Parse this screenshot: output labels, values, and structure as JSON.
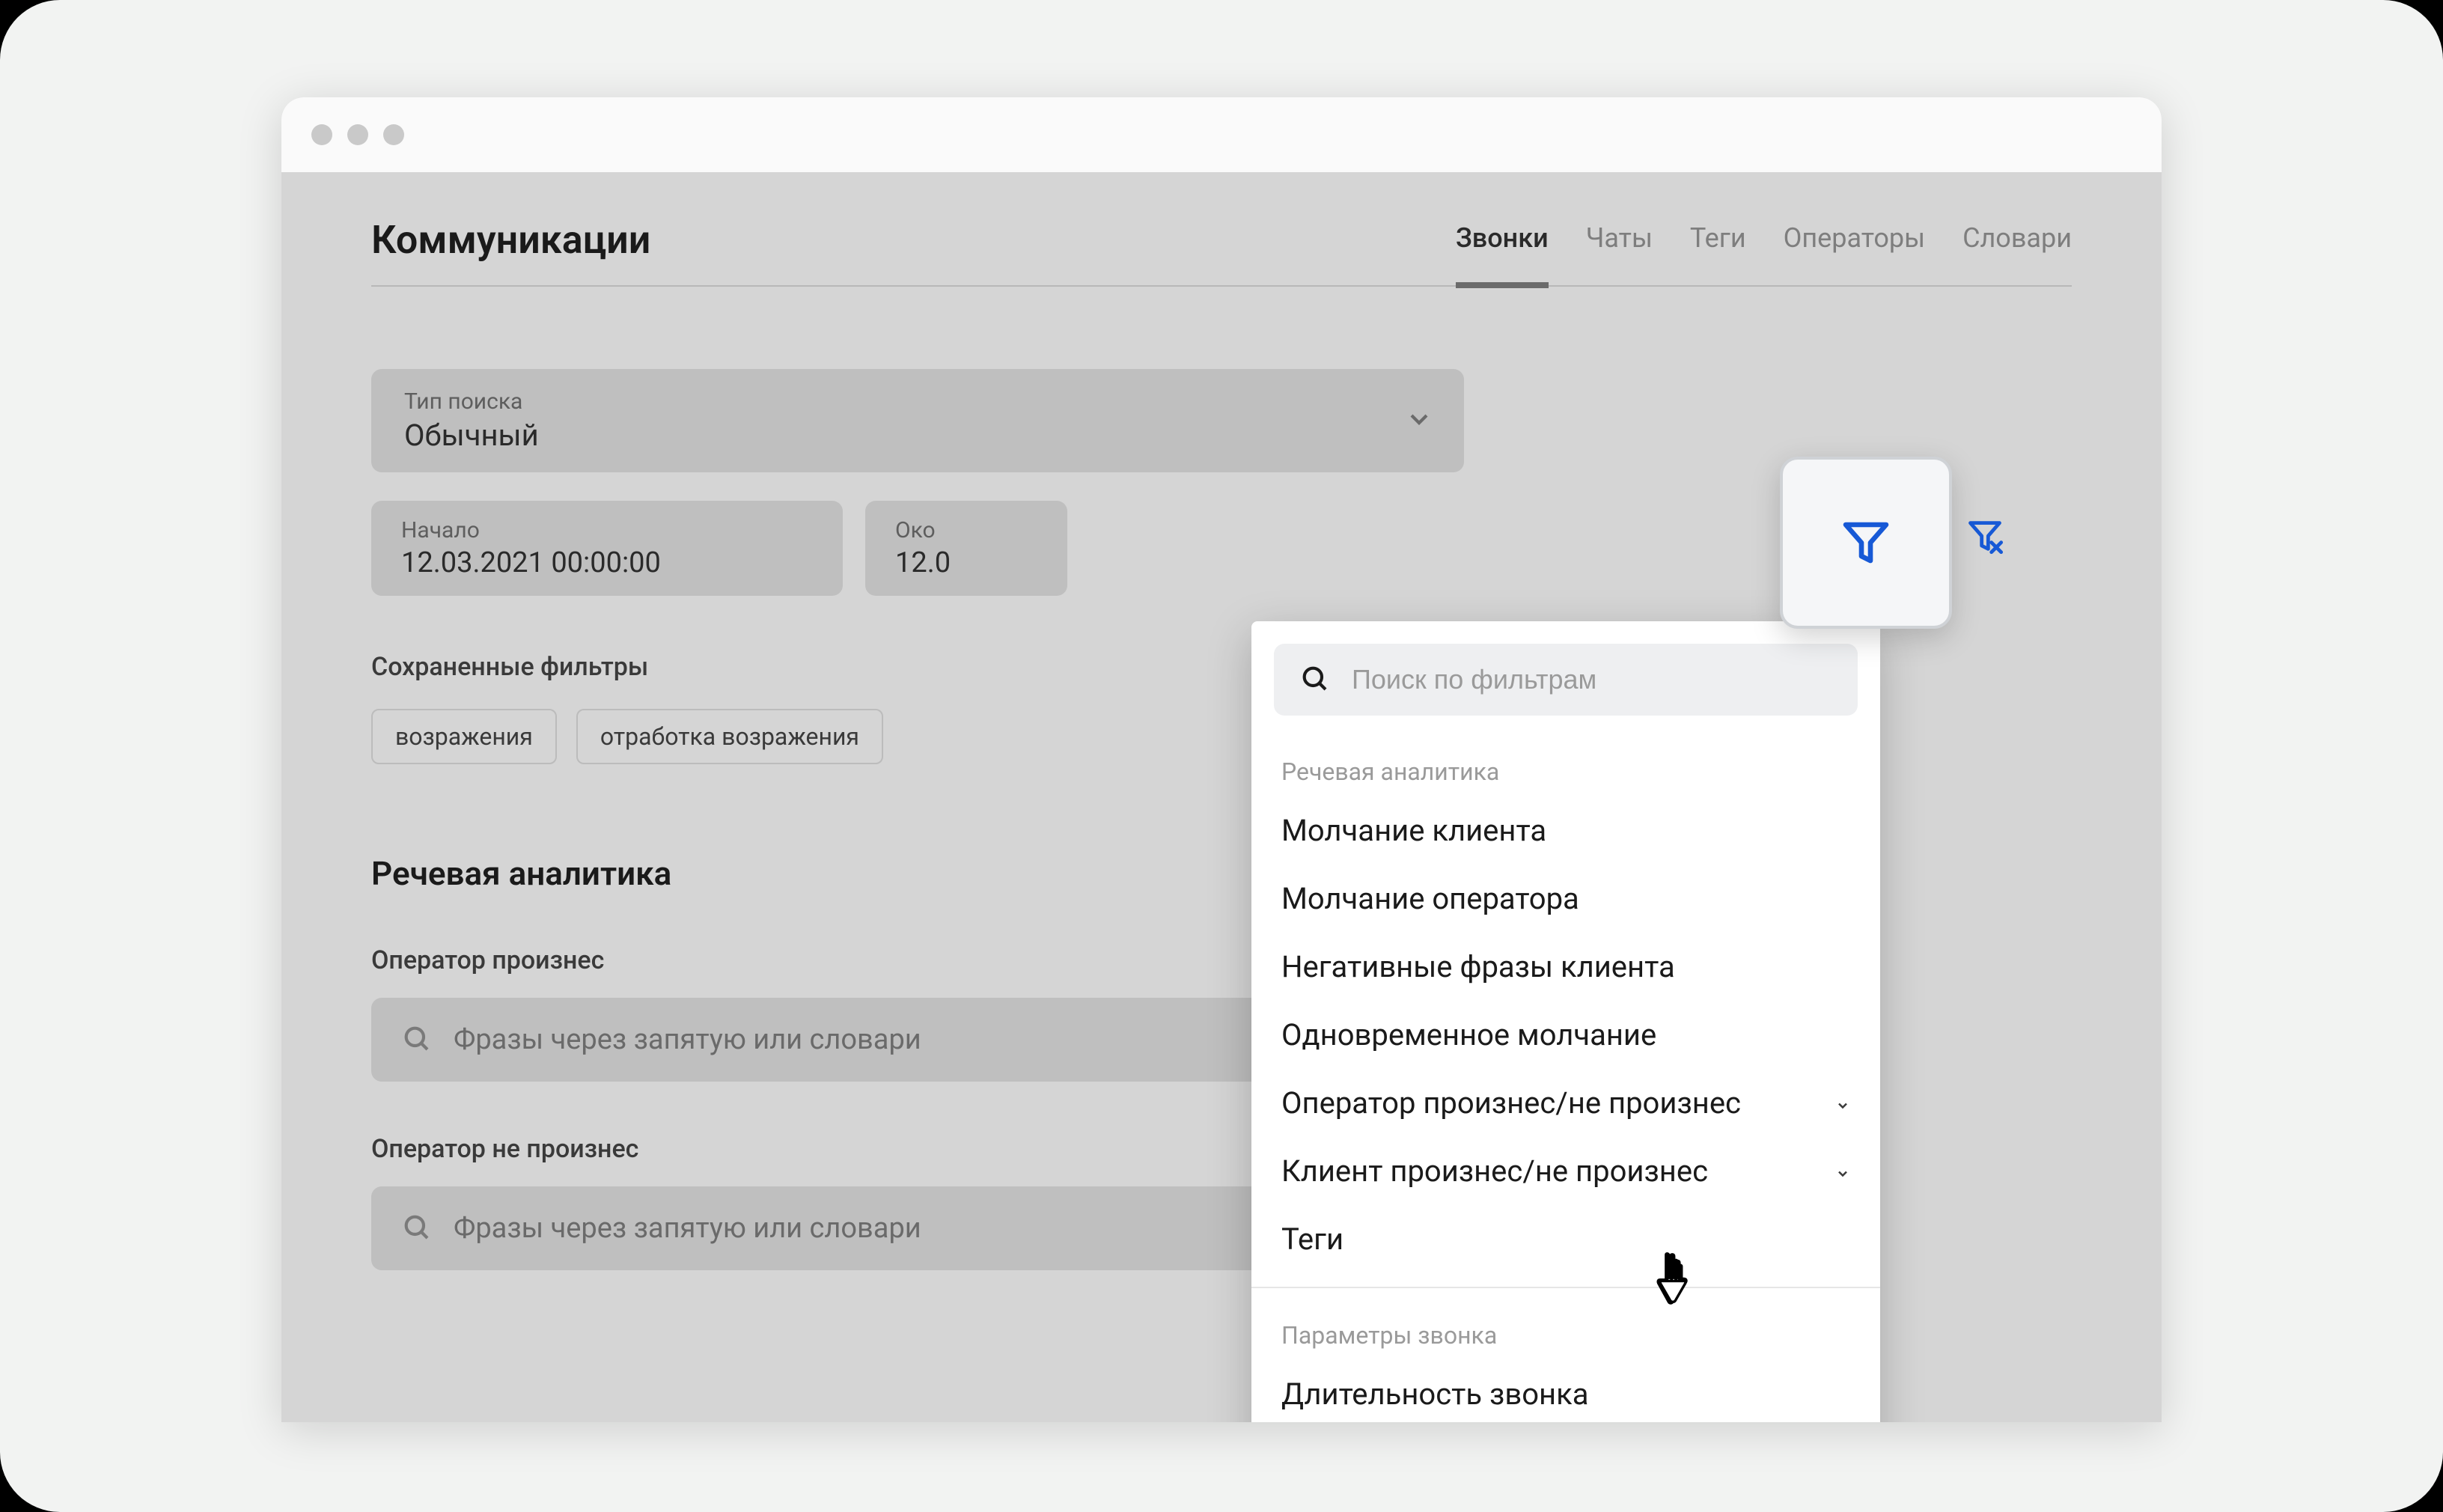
{
  "header": {
    "title": "Коммуникации",
    "tabs": [
      {
        "label": "Звонки",
        "active": true
      },
      {
        "label": "Чаты",
        "active": false
      },
      {
        "label": "Теги",
        "active": false
      },
      {
        "label": "Операторы",
        "active": false
      },
      {
        "label": "Словари",
        "active": false
      }
    ]
  },
  "search_type": {
    "label": "Тип поиска",
    "value": "Обычный"
  },
  "dates": {
    "start_label": "Начало",
    "start_value": "12.03.2021 00:00:00",
    "end_label": "Око",
    "end_value": "12.0"
  },
  "saved_filters": {
    "label": "Сохраненные фильтры",
    "chips": [
      "возражения",
      "отработка возражения"
    ]
  },
  "speech": {
    "section_title": "Речевая аналитика",
    "field1_label": "Оператор произнес",
    "field2_label": "Оператор не произнес",
    "placeholder": "Фразы через запятую или словари"
  },
  "popover": {
    "search_placeholder": "Поиск по фильтрам",
    "group1_label": "Речевая аналитика",
    "group1_items": [
      "Молчание клиента",
      "Молчание оператора",
      "Негативные фразы клиента",
      "Одновременное молчание",
      "Оператор произнес/не произнес",
      "Клиент произнес/не произнес",
      "Теги"
    ],
    "group2_label": "Параметры звонка",
    "group2_items": [
      "Длительность звонка"
    ]
  },
  "colors": {
    "accent": "#1759d6"
  }
}
